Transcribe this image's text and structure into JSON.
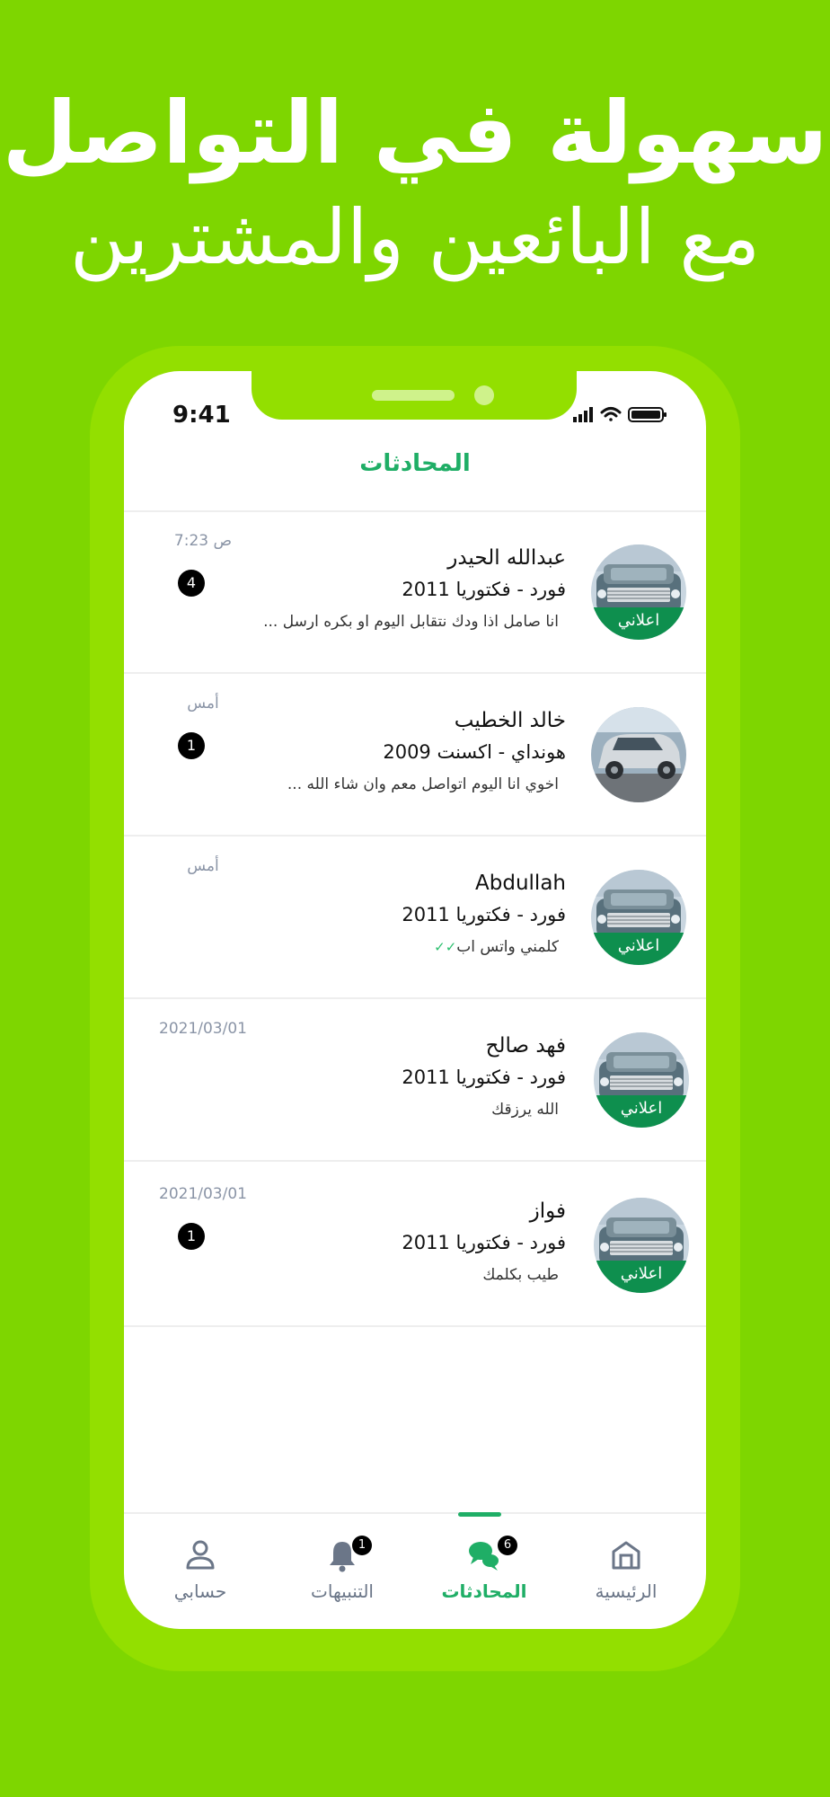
{
  "headline": {
    "line1": "سهولة في التواصل",
    "line2": "مع البائعين والمشترين"
  },
  "status_bar": {
    "time": "9:41"
  },
  "screen_title": "المحادثات",
  "avatar_tag": "اعلاني",
  "conversations": [
    {
      "name": "عبدالله الحيدر",
      "car": "فورد - فكتوريا 2011",
      "message": "انا صامل اذا ودك نتقابل اليوم او بكره ارسل ...",
      "time": "7:23 ص",
      "unread": "4",
      "avatar": "ford",
      "read": false
    },
    {
      "name": "خالد الخطيب",
      "car": "هونداي - اكسنت 2009",
      "message": "اخوي انا اليوم اتواصل معم وان شاء الله ...",
      "time": "أمس",
      "unread": "1",
      "avatar": "hyundai",
      "read": false
    },
    {
      "name": "Abdullah",
      "car": "فورد - فكتوريا 2011",
      "message": "كلمني واتس اب",
      "time": "أمس",
      "unread": "",
      "avatar": "ford",
      "read": true
    },
    {
      "name": "فهد صالح",
      "car": "فورد - فكتوريا 2011",
      "message": "الله يرزقك",
      "time": "2021/03/01",
      "unread": "",
      "avatar": "ford",
      "read": false
    },
    {
      "name": "فواز",
      "car": "فورد - فكتوريا 2011",
      "message": "طيب بكلمك",
      "time": "2021/03/01",
      "unread": "1",
      "avatar": "ford",
      "read": false
    }
  ],
  "tabs": [
    {
      "label": "حسابي",
      "icon": "user-icon",
      "badge": ""
    },
    {
      "label": "التنبيهات",
      "icon": "bell-icon",
      "badge": "1"
    },
    {
      "label": "المحادثات",
      "icon": "chat-icon",
      "badge": "6"
    },
    {
      "label": "الرئيسية",
      "icon": "home-icon",
      "badge": ""
    }
  ],
  "colors": {
    "background": "#7ed600",
    "accent": "#1fae66",
    "tag": "#0e8f4e"
  }
}
